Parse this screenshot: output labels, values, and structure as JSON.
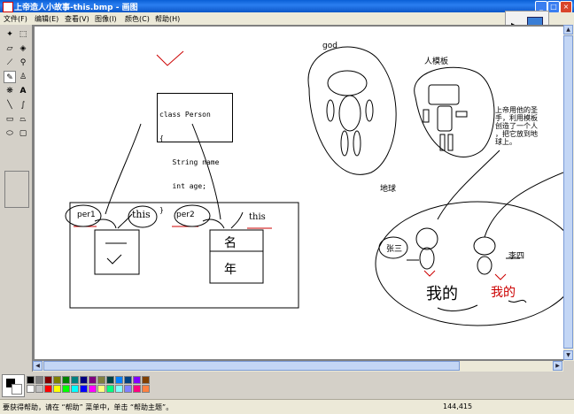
{
  "window": {
    "title": "上帝造人小故事-this.bmp - 画图"
  },
  "menu": [
    "文件(F)",
    "编辑(E)",
    "查看(V)",
    "图像(I)",
    "颜色(C)",
    "帮助(H)"
  ],
  "tools": [
    "free-select",
    "rect-select",
    "eraser",
    "fill",
    "picker",
    "magnifier",
    "pencil",
    "brush",
    "airbrush",
    "text",
    "line",
    "curve",
    "rectangle",
    "polygon",
    "ellipse",
    "rounded-rect"
  ],
  "drawing": {
    "code_lines": [
      "class Person",
      "{",
      "   String name",
      "   int age;",
      "}"
    ],
    "god": "god",
    "template": "人模板",
    "note_lines": [
      "上帝用他的圣",
      "手，利用模板",
      "创造了一个人",
      "，把它放到地",
      "球上。"
    ],
    "earth": "地球",
    "per1": "per1",
    "per2": "per2",
    "this1": "this",
    "this2": "this",
    "name_cell": "名",
    "age_cell": "年",
    "zhangsan": "张三",
    "lisi": "李四",
    "mine1": "我的",
    "mine2": "我的"
  },
  "palette_colors": [
    "#000000",
    "#808080",
    "#800000",
    "#808000",
    "#008000",
    "#008080",
    "#000080",
    "#800080",
    "#808040",
    "#004040",
    "#0080ff",
    "#004080",
    "#8000ff",
    "#804000",
    "#ffffff",
    "#c0c0c0",
    "#ff0000",
    "#ffff00",
    "#00ff00",
    "#00ffff",
    "#0000ff",
    "#ff00ff",
    "#ffff80",
    "#00ff80",
    "#80ffff",
    "#8080ff",
    "#ff0080",
    "#ff8040"
  ],
  "status": {
    "help": "要获得帮助，请在 “帮助” 菜单中，单击 “帮助主题”。",
    "coords": "144,415"
  }
}
